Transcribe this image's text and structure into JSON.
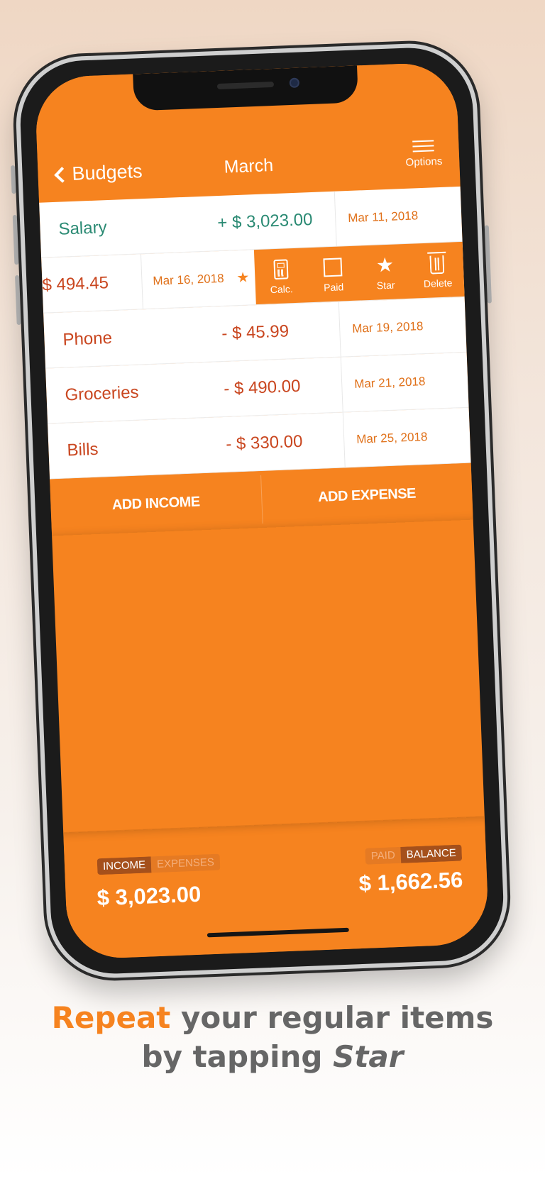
{
  "nav": {
    "back_label": "Budgets",
    "title": "March",
    "options_label": "Options"
  },
  "rows": [
    {
      "type": "income",
      "name": "Salary",
      "amount": "+ $ 3,023.00",
      "date": "Mar 11, 2018"
    },
    {
      "type": "swiped",
      "amount": "$ 494.45",
      "date": "Mar 16, 2018",
      "starred": true
    },
    {
      "type": "expense",
      "name": "Phone",
      "amount": "- $ 45.99",
      "date": "Mar 19, 2018"
    },
    {
      "type": "expense",
      "name": "Groceries",
      "amount": "- $ 490.00",
      "date": "Mar 21, 2018"
    },
    {
      "type": "expense",
      "name": "Bills",
      "amount": "- $ 330.00",
      "date": "Mar 25, 2018"
    }
  ],
  "swipe_actions": [
    {
      "label": "Calc.",
      "icon": "calculator-icon"
    },
    {
      "label": "Paid",
      "icon": "checkbox-icon"
    },
    {
      "label": "Star",
      "icon": "star-icon"
    },
    {
      "label": "Delete",
      "icon": "trash-icon"
    }
  ],
  "buttons": {
    "add_income": "ADD INCOME",
    "add_expense": "ADD EXPENSE"
  },
  "footer": {
    "left_tabs": [
      "INCOME",
      "EXPENSES"
    ],
    "left_total": "$ 3,023.00",
    "right_tabs": [
      "PAID",
      "BALANCE"
    ],
    "right_total": "$ 1,662.56"
  },
  "caption": {
    "highlight": "Repeat",
    "line1_rest": " your regular items",
    "line2_pre": "by tapping ",
    "line2_italic": "Star"
  },
  "colors": {
    "accent": "#f6831f",
    "income_text": "#2a8a73",
    "expense_text": "#c9461f"
  }
}
